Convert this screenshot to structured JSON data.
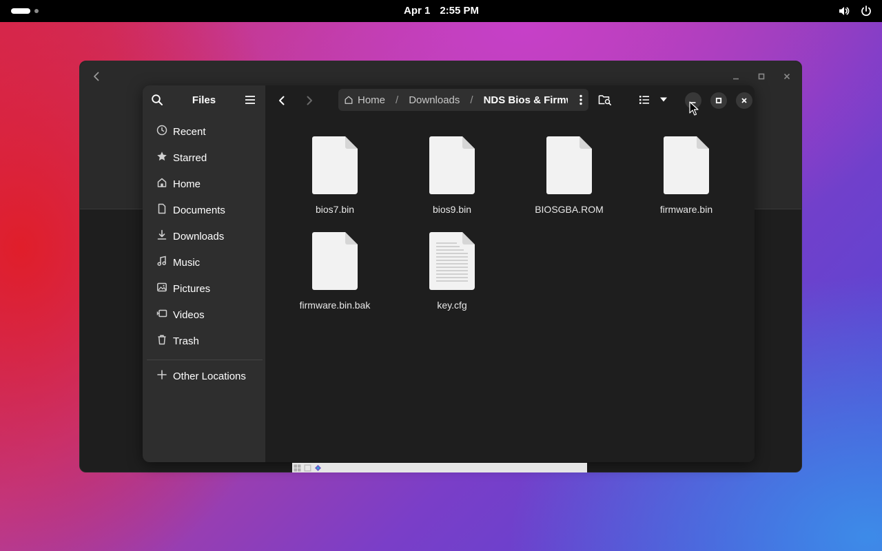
{
  "topbar": {
    "date": "Apr 1",
    "time": "2:55 PM",
    "icons": [
      "activities-indicator",
      "volume-icon",
      "power-icon"
    ]
  },
  "sidebar": {
    "title": "Files",
    "items": [
      {
        "label": "Recent",
        "icon": "clock-icon"
      },
      {
        "label": "Starred",
        "icon": "star-icon"
      },
      {
        "label": "Home",
        "icon": "home-icon"
      },
      {
        "label": "Documents",
        "icon": "document-icon"
      },
      {
        "label": "Downloads",
        "icon": "download-icon"
      },
      {
        "label": "Music",
        "icon": "music-icon"
      },
      {
        "label": "Pictures",
        "icon": "picture-icon"
      },
      {
        "label": "Videos",
        "icon": "video-icon"
      },
      {
        "label": "Trash",
        "icon": "trash-icon"
      }
    ],
    "other_locations": "Other Locations"
  },
  "pathbar": {
    "home": "Home",
    "downloads": "Downloads",
    "current": "NDS Bios & Firmw"
  },
  "files": [
    {
      "name": "bios7.bin",
      "type": "binary"
    },
    {
      "name": "bios9.bin",
      "type": "binary"
    },
    {
      "name": "BIOSGBA.ROM",
      "type": "binary"
    },
    {
      "name": "firmware.bin",
      "type": "binary"
    },
    {
      "name": "firmware.bin.bak",
      "type": "binary"
    },
    {
      "name": "key.cfg",
      "type": "text"
    }
  ],
  "colors": {
    "window_bg": "#1e1e1e",
    "sidebar_bg": "#2e2e2e",
    "pathbar_bg": "#303030",
    "file_icon": "#f2f2f2"
  }
}
